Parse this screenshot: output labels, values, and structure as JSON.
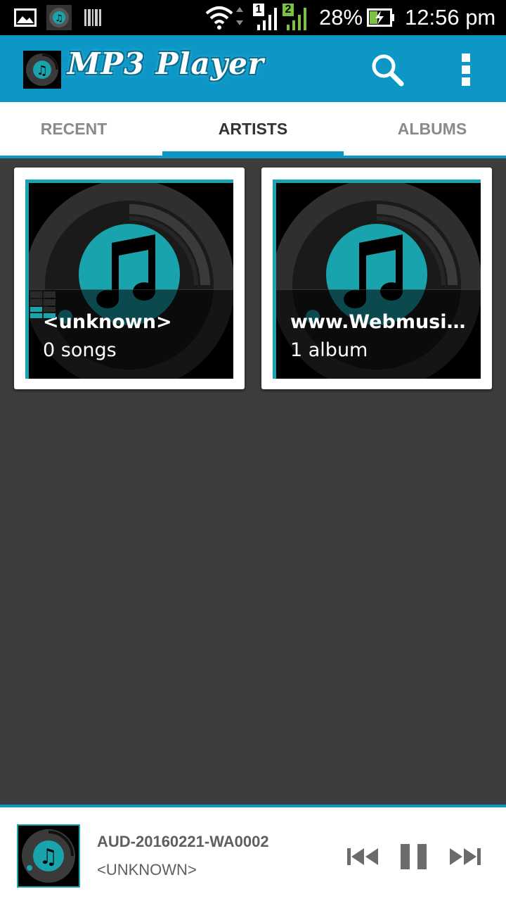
{
  "status_bar": {
    "sim1_label": "1",
    "sim2_label": "2",
    "battery_percent": "28%",
    "time": "12:56 pm",
    "icons": [
      "gallery-notification-icon",
      "mp3-player-notification-icon",
      "barcode-notification-icon",
      "wifi-icon",
      "signal-sim1-icon",
      "signal-sim2-icon",
      "battery-charging-icon"
    ]
  },
  "app_bar": {
    "title": "MP3 Player",
    "color": "#0d97c6"
  },
  "tabs": [
    {
      "label": "RECENT",
      "active": false
    },
    {
      "label": "ARTISTS",
      "active": true
    },
    {
      "label": "ALBUMS",
      "active": false
    }
  ],
  "artists": [
    {
      "name": "<unknown>",
      "count": "0 songs",
      "now_playing": true
    },
    {
      "name": "www.Webmusi…",
      "count": "1 album",
      "now_playing": false
    }
  ],
  "now_playing": {
    "title": "AUD-20160221-WA0002",
    "artist": "<UNKNOWN>"
  },
  "colors": {
    "accent": "#0d97c6",
    "art_teal": "#19a3ad",
    "background": "#3d3d3d"
  }
}
